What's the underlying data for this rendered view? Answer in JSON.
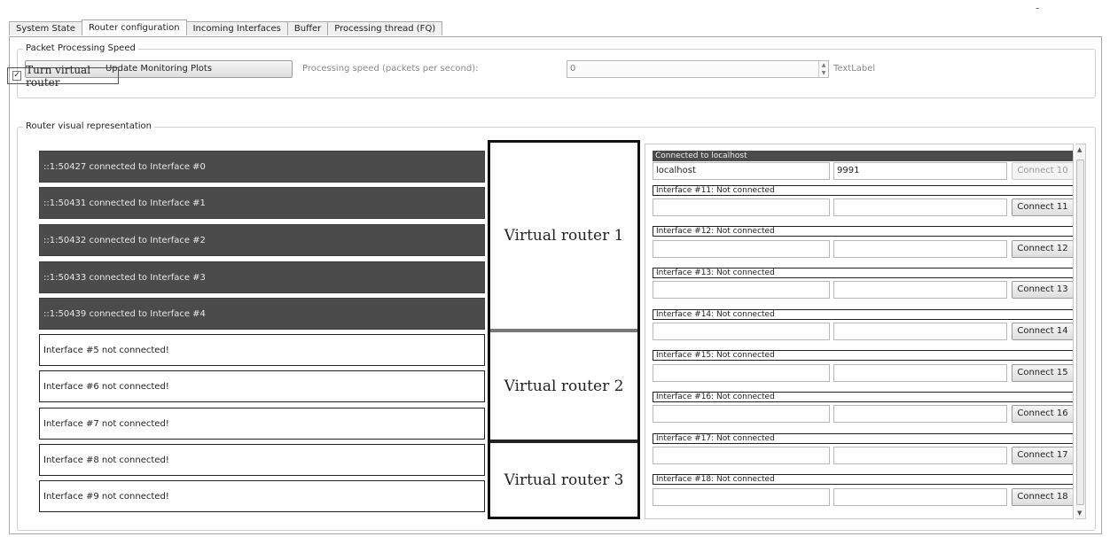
{
  "window": {
    "minimize_glyph": "-"
  },
  "tabs": [
    "System State",
    "Router configuration",
    "Incoming Interfaces",
    "Buffer",
    "Processing thread (FQ)"
  ],
  "packet_speed": {
    "group_title": "Packet Processing Speed",
    "update_button": "Update Monitoring Plots",
    "speed_label": "Processing speed (packets per second):",
    "speed_value": "0",
    "text_label": "TextLabel"
  },
  "virtual_router_toggle": {
    "label": "Turn virtual router",
    "checked": true,
    "check_glyph": "✓"
  },
  "visual": {
    "group_title": "Router visual representation",
    "interfaces": [
      "::1:50427 connected to Interface #0",
      "::1:50431 connected to Interface #1",
      "::1:50432 connected to Interface #2",
      "::1:50433 connected to Interface #3",
      "::1:50439 connected to Interface #4",
      "Interface #5 not connected!",
      "Interface #6 not connected!",
      "Interface #7 not connected!",
      "Interface #8 not connected!",
      "Interface #9 not connected!"
    ],
    "routers": [
      "Virtual router 1",
      "Virtual router 2",
      "Virtual router 3"
    ]
  },
  "connections": {
    "header": "Connected to localhost",
    "host": "localhost",
    "port": "9991",
    "connect10": "Connect 10",
    "entries": [
      {
        "status": "Interface #11: Not connected",
        "button": "Connect 11"
      },
      {
        "status": "Interface #12: Not connected",
        "button": "Connect 12"
      },
      {
        "status": "Interface #13: Not connected",
        "button": "Connect 13"
      },
      {
        "status": "Interface #14: Not connected",
        "button": "Connect 14"
      },
      {
        "status": "Interface #15: Not connected",
        "button": "Connect 15"
      },
      {
        "status": "Interface #16: Not connected",
        "button": "Connect 16"
      },
      {
        "status": "Interface #17: Not connected",
        "button": "Connect 17"
      },
      {
        "status": "Interface #18: Not connected",
        "button": "Connect 18"
      }
    ]
  }
}
